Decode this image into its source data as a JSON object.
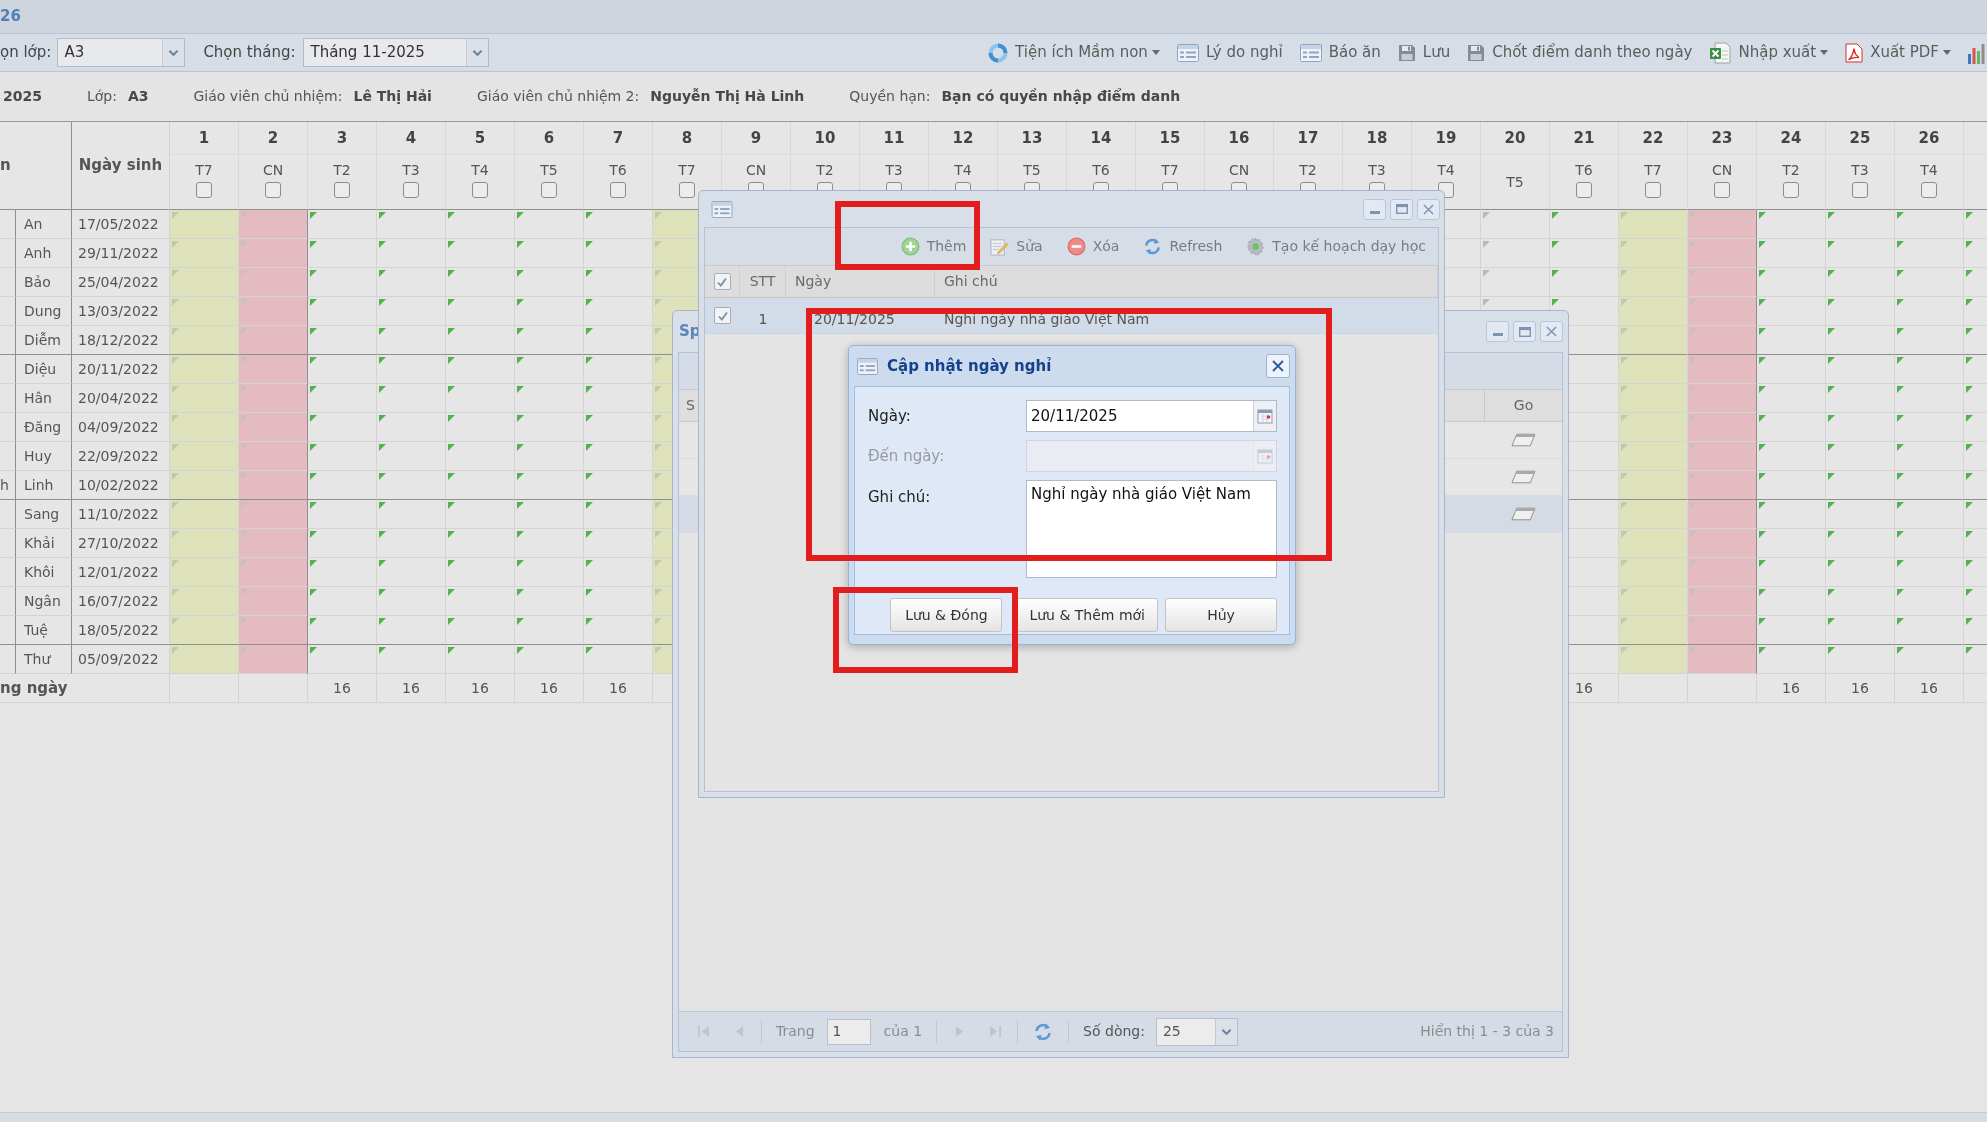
{
  "app_header": {
    "title": "26"
  },
  "toolbar": {
    "filters": [
      {
        "label": "ọn lớp:",
        "value": "A3"
      },
      {
        "label": "Chọn tháng:",
        "value": "Tháng 11-2025"
      }
    ],
    "actions": [
      {
        "label": "Tiện ích Mầm non",
        "dropdown": true
      },
      {
        "label": "Lý do nghỉ",
        "dropdown": false
      },
      {
        "label": "Báo ăn",
        "dropdown": false
      },
      {
        "label": "Lưu",
        "dropdown": false
      },
      {
        "label": "Chốt điểm danh theo ngày",
        "dropdown": false
      },
      {
        "label": "Nhập xuất",
        "dropdown": true
      },
      {
        "label": "Xuất PDF",
        "dropdown": true
      },
      {
        "dropdown": false
      }
    ]
  },
  "class_info": [
    {
      "value": "2025"
    },
    {
      "label": "Lớp:",
      "value": "A3"
    },
    {
      "label": "Giáo viên chủ nhiệm:",
      "value": "Lê Thị Hải"
    },
    {
      "label": "Giáo viên chủ nhiệm 2:",
      "value": "Nguyễn Thị Hà Linh"
    },
    {
      "label": "Quyền hạn:",
      "value": "Bạn có quyền nhập điểm danh"
    }
  ],
  "attendance_table": {
    "columns": {
      "column_1": "n",
      "birth_date": "Ngày sinh"
    },
    "days": [
      {
        "day": "1",
        "weekday": "T7",
        "kind": "saturday",
        "checked": false
      },
      {
        "day": "2",
        "weekday": "CN",
        "kind": "sunday",
        "checked": false
      },
      {
        "day": "3",
        "weekday": "T2",
        "kind": "weekday",
        "checked": false,
        "total": "16"
      },
      {
        "day": "4",
        "weekday": "T3",
        "kind": "weekday",
        "checked": false,
        "total": "16"
      },
      {
        "day": "5",
        "weekday": "T4",
        "kind": "weekday",
        "checked": false,
        "total": "16"
      },
      {
        "day": "6",
        "weekday": "T5",
        "kind": "weekday",
        "checked": false,
        "total": "16"
      },
      {
        "day": "7",
        "weekday": "T6",
        "kind": "weekday",
        "checked": false,
        "total": "16"
      },
      {
        "day": "8",
        "weekday": "T7",
        "kind": "saturday",
        "checked": false
      },
      {
        "day": "9",
        "weekday": "CN",
        "kind": "sunday",
        "checked": false
      },
      {
        "day": "10",
        "weekday": "T2",
        "kind": "weekday",
        "checked": false
      },
      {
        "day": "11",
        "weekday": "T3",
        "kind": "weekday",
        "checked": false
      },
      {
        "day": "12",
        "weekday": "T4",
        "kind": "weekday",
        "checked": false
      },
      {
        "day": "13",
        "weekday": "T5",
        "kind": "weekday",
        "checked": false
      },
      {
        "day": "14",
        "weekday": "T6",
        "kind": "weekday",
        "checked": false
      },
      {
        "day": "15",
        "weekday": "T7",
        "kind": "saturday",
        "checked": false
      },
      {
        "day": "16",
        "weekday": "CN",
        "kind": "sunday",
        "checked": false
      },
      {
        "day": "17",
        "weekday": "T2",
        "kind": "weekday",
        "checked": false
      },
      {
        "day": "18",
        "weekday": "T3",
        "kind": "weekday",
        "checked": false
      },
      {
        "day": "19",
        "weekday": "T4",
        "kind": "weekday",
        "checked": false
      },
      {
        "day": "20",
        "weekday": "T5",
        "kind": "holiday"
      },
      {
        "day": "21",
        "weekday": "T6",
        "kind": "weekday",
        "checked": false,
        "total": "16"
      },
      {
        "day": "22",
        "weekday": "T7",
        "kind": "saturday",
        "checked": false
      },
      {
        "day": "23",
        "weekday": "CN",
        "kind": "sunday",
        "checked": false
      },
      {
        "day": "24",
        "weekday": "T2",
        "kind": "weekday",
        "checked": false,
        "total": "16"
      },
      {
        "day": "25",
        "weekday": "T3",
        "kind": "weekday",
        "checked": false,
        "total": "16"
      },
      {
        "day": "26",
        "weekday": "T4",
        "kind": "weekday",
        "checked": false,
        "total": "16"
      },
      {
        "kind": "weekday"
      }
    ],
    "rows": [
      {
        "name": "An",
        "birth_date": "17/05/2022"
      },
      {
        "name": "Anh",
        "birth_date": "29/11/2022"
      },
      {
        "name": "Bảo",
        "birth_date": "25/04/2022"
      },
      {
        "name": "Dung",
        "birth_date": "13/03/2022"
      },
      {
        "name": "Diễm",
        "birth_date": "18/12/2022"
      },
      {
        "name": "Diệu",
        "birth_date": "20/11/2022"
      },
      {
        "name": "Hân",
        "birth_date": "20/04/2022"
      },
      {
        "name": "Đăng",
        "birth_date": "04/09/2022"
      },
      {
        "name": "Huy",
        "birth_date": "22/09/2022"
      },
      {
        "column_1": "h",
        "name": "Linh",
        "birth_date": "10/02/2022"
      },
      {
        "name": "Sang",
        "birth_date": "11/10/2022"
      },
      {
        "name": "Khải",
        "birth_date": "27/10/2022"
      },
      {
        "name": "Khôi",
        "birth_date": "12/01/2022"
      },
      {
        "name": "Ngân",
        "birth_date": "16/07/2022"
      },
      {
        "name": "Tuệ",
        "birth_date": "18/05/2022"
      },
      {
        "name": "Thư",
        "birth_date": "05/09/2022"
      }
    ],
    "footer_label": "ng ngày"
  },
  "schedule_window": {
    "title": "Sp",
    "columns": {
      "column_1": "S",
      "go": "Go"
    },
    "rows": [
      {
        "selected": false
      },
      {
        "selected": false
      },
      {
        "selected": true
      }
    ],
    "pager": {
      "items": [
        {
          "kind": "first",
          "disabled": true
        },
        {
          "kind": "prev",
          "disabled": true
        },
        {
          "kind": "page",
          "label": "Trang",
          "value": "1",
          "suffix": "của 1"
        },
        {
          "kind": "next",
          "disabled": true
        },
        {
          "kind": "last",
          "disabled": true
        },
        {
          "kind": "refresh",
          "disabled": false
        },
        {
          "kind": "page_size",
          "label": "Số dòng:",
          "value": "25"
        }
      ],
      "summary": "Hiển thị 1 - 3 của 3"
    }
  },
  "holiday_window": {
    "toolbar": [
      {
        "label": "Thêm"
      },
      {
        "label": "Sửa"
      },
      {
        "label": "Xóa"
      },
      {
        "label": "Refresh"
      },
      {
        "label": "Tạo kế hoạch dạy học"
      }
    ],
    "select_all_checked": true,
    "columns": [
      "STT",
      "Ngày",
      "Ghi chú"
    ],
    "rows": [
      {
        "checked": true,
        "selected": true,
        "stt": "1",
        "date": "20/11/2025",
        "note": "Nghỉ ngày nhà giáo Việt Nam"
      }
    ]
  },
  "update_dialog": {
    "title": "Cập nhật ngày nghỉ",
    "fields": [
      {
        "label": "Ngày:",
        "kind": "date",
        "value": "20/11/2025",
        "disabled": false
      },
      {
        "label": "Đến ngày:",
        "kind": "date",
        "disabled": true
      },
      {
        "label": "Ghi chú:",
        "kind": "textarea",
        "value": "Nghỉ ngày nhà giáo Việt Nam",
        "disabled": false
      }
    ],
    "buttons": [
      "Lưu & Đóng",
      "Lưu & Thêm mới",
      "Hủy"
    ]
  }
}
